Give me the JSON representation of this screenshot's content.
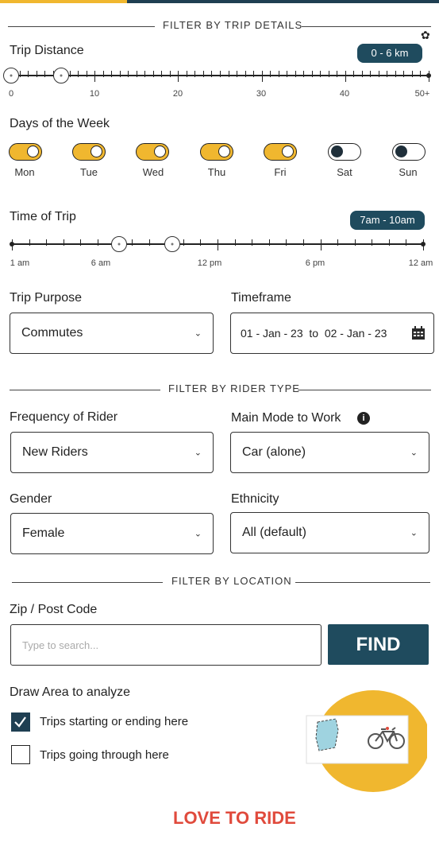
{
  "sections": {
    "trip_details": "FILTER BY TRIP DETAILS",
    "rider_type": "FILTER BY RIDER TYPE",
    "location": "FILTER BY LOCATION"
  },
  "trip_distance": {
    "label": "Trip Distance",
    "badge": "0 - 6 km",
    "tick_labels": [
      "0",
      "10",
      "20",
      "30",
      "40",
      "50+"
    ],
    "range_min": 0,
    "range_max": 50,
    "selected": [
      0,
      6
    ]
  },
  "days": {
    "label": "Days of the Week",
    "items": [
      {
        "name": "Mon",
        "on": true
      },
      {
        "name": "Tue",
        "on": true
      },
      {
        "name": "Wed",
        "on": true
      },
      {
        "name": "Thu",
        "on": true
      },
      {
        "name": "Fri",
        "on": true
      },
      {
        "name": "Sat",
        "on": false
      },
      {
        "name": "Sun",
        "on": false
      }
    ]
  },
  "time_of_trip": {
    "label": "Time of Trip",
    "badge": "7am - 10am",
    "tick_labels": [
      "1 am",
      "6 am",
      "12 pm",
      "6 pm",
      "12 am"
    ]
  },
  "trip_purpose": {
    "label": "Trip Purpose",
    "value": "Commutes"
  },
  "timeframe": {
    "label": "Timeframe",
    "value": "01 - Jan - 23  to  02 - Jan - 23"
  },
  "frequency": {
    "label": "Frequency of Rider",
    "value": "New Riders"
  },
  "main_mode": {
    "label": "Main Mode to Work",
    "value": "Car (alone)"
  },
  "gender": {
    "label": "Gender",
    "value": "Female"
  },
  "ethnicity": {
    "label": "Ethnicity",
    "value": "All (default)"
  },
  "zip": {
    "label": "Zip / Post Code",
    "placeholder": "Type to search...",
    "button": "FIND"
  },
  "draw_area": {
    "label": "Draw Area to analyze",
    "options": [
      {
        "label": "Trips starting or ending here",
        "checked": true
      },
      {
        "label": "Trips going through here",
        "checked": false
      }
    ]
  },
  "brand": {
    "logo": "LOVE TO RIDE"
  },
  "colors": {
    "accent": "#f0b72f",
    "primary": "#1f4b5e",
    "brand_red": "#e04a3c"
  }
}
